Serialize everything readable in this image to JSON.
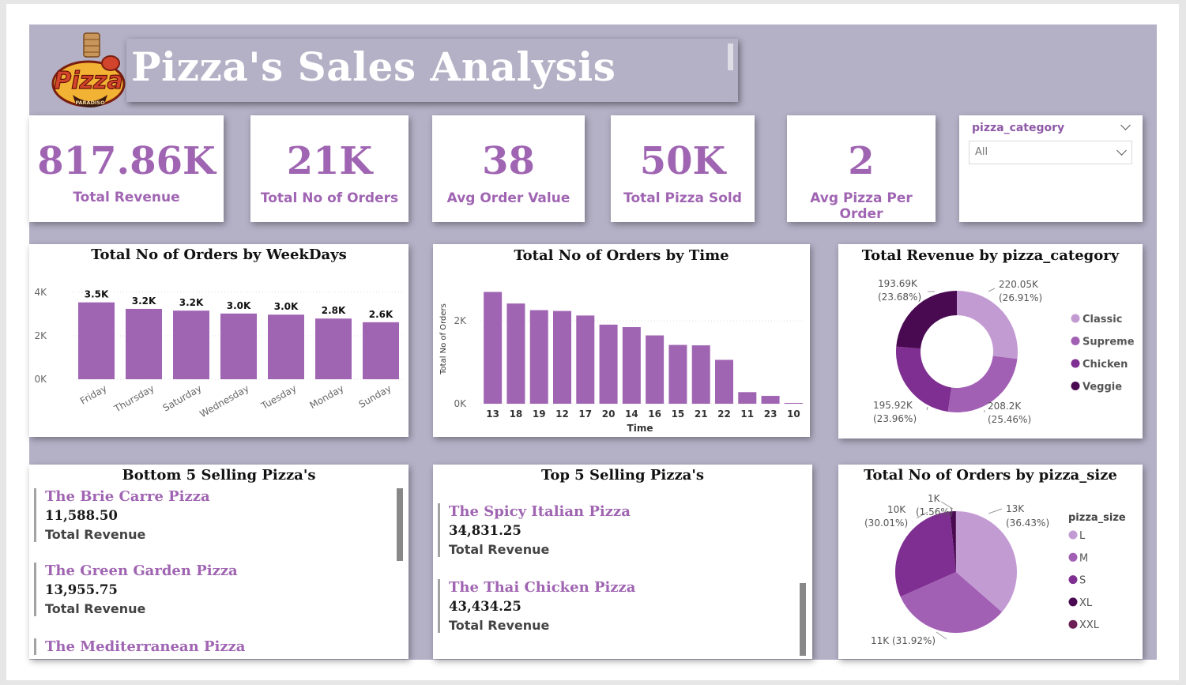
{
  "header": {
    "title": "Pizza's Sales Analysis",
    "logo_text": "Pizza",
    "logo_subtext": "PARADISO"
  },
  "kpis": [
    {
      "value": "817.86K",
      "label": "Total Revenue"
    },
    {
      "value": "21K",
      "label": "Total No of Orders"
    },
    {
      "value": "38",
      "label": "Avg Order Value"
    },
    {
      "value": "50K",
      "label": "Total Pizza Sold"
    },
    {
      "value": "2",
      "label": "Avg Pizza Per Order"
    }
  ],
  "slicer": {
    "title": "pizza_category",
    "selected": "All"
  },
  "weekday_chart": {
    "title": "Total No of Orders by WeekDays",
    "chart_data": {
      "type": "bar",
      "categories": [
        "Friday",
        "Thursday",
        "Saturday",
        "Wednesday",
        "Tuesday",
        "Monday",
        "Sunday"
      ],
      "values": [
        3538,
        3239,
        3158,
        3024,
        2973,
        2794,
        2624
      ],
      "data_labels": [
        "3.5K",
        "3.2K",
        "3.2K",
        "3.0K",
        "3.0K",
        "2.8K",
        "2.6K"
      ],
      "yticks": [
        "0K",
        "2K",
        "4K"
      ],
      "ylim": [
        0,
        4400
      ],
      "bar_color": "#a065b2"
    }
  },
  "time_chart": {
    "title": "Total No of Orders by Time",
    "chart_data": {
      "type": "bar",
      "categories": [
        "13",
        "18",
        "19",
        "12",
        "17",
        "20",
        "14",
        "16",
        "15",
        "21",
        "22",
        "11",
        "23",
        "10"
      ],
      "values": [
        2700,
        2420,
        2260,
        2240,
        2130,
        1910,
        1850,
        1650,
        1420,
        1410,
        1060,
        280,
        190,
        20
      ],
      "yticks": [
        "0K",
        "2K"
      ],
      "ylim": [
        0,
        2900
      ],
      "xlabel": "Time",
      "ylabel": "Total No of Orders",
      "bar_color": "#a065b2"
    }
  },
  "category_chart": {
    "title": "Total Revenue by pizza_category",
    "chart_data": {
      "type": "pie",
      "donut": true,
      "legend_position": "right",
      "slices": [
        {
          "name": "Classic",
          "value": 220050,
          "label_value": "220.05K",
          "label_pct": "(26.91%)",
          "color": "#c39bd3"
        },
        {
          "name": "Supreme",
          "value": 208200,
          "label_value": "208.2K",
          "label_pct": "(25.46%)",
          "color": "#a260b5"
        },
        {
          "name": "Chicken",
          "value": 195920,
          "label_value": "195.92K",
          "label_pct": "(23.96%)",
          "color": "#7f2f91"
        },
        {
          "name": "Veggie",
          "value": 193690,
          "label_value": "193.69K",
          "label_pct": "(23.68%)",
          "color": "#4a0a52"
        }
      ]
    }
  },
  "size_chart": {
    "title": "Total No of Orders by pizza_size",
    "legend_title": "pizza_size",
    "chart_data": {
      "type": "pie",
      "legend_position": "right",
      "slices": [
        {
          "name": "L",
          "value": 36.43,
          "label": "13K",
          "label_pct": "(36.43%)",
          "color": "#c39bd3"
        },
        {
          "name": "M",
          "value": 31.92,
          "label": "11K (31.92%)",
          "color": "#a260b5"
        },
        {
          "name": "S",
          "value": 30.01,
          "label": "10K",
          "label_pct": "(30.01%)",
          "color": "#7f2f91"
        },
        {
          "name": "XL",
          "value": 1.56,
          "label": "1K",
          "label_pct": "(1.56%)",
          "color": "#4a0a52"
        },
        {
          "name": "XXL",
          "value": 0.08,
          "color": "#6b1f55"
        }
      ]
    }
  },
  "bottom5": {
    "title": "Bottom 5 Selling Pizza's",
    "items": [
      {
        "name": "The Brie Carre Pizza",
        "value": "11,588.50",
        "label": "Total Revenue"
      },
      {
        "name": "The Green Garden Pizza",
        "value": "13,955.75",
        "label": "Total Revenue"
      },
      {
        "name": "The Mediterranean Pizza"
      }
    ]
  },
  "top5": {
    "title": "Top 5 Selling Pizza's",
    "items": [
      {
        "name": "The Spicy Italian Pizza",
        "value": "34,831.25",
        "label": "Total Revenue"
      },
      {
        "name": "The Thai Chicken Pizza",
        "value": "43,434.25",
        "label": "Total Revenue"
      }
    ]
  }
}
